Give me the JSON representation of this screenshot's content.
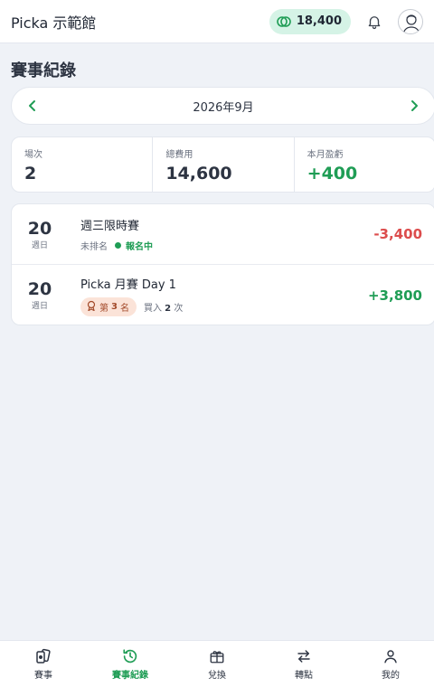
{
  "header": {
    "title": "Picka 示範館",
    "coins": "18,400",
    "icons": {
      "coin": "coin-icon",
      "bell": "bell-icon",
      "avatar": "avatar-icon"
    }
  },
  "page": {
    "title": "賽事紀錄"
  },
  "month_nav": {
    "label": "2026年9月",
    "prev_icon": "chevron-left-icon",
    "next_icon": "chevron-right-icon"
  },
  "stats": [
    {
      "label": "場次",
      "value": "2"
    },
    {
      "label": "總費用",
      "value": "14,600"
    },
    {
      "label": "本月盈虧",
      "value": "+400"
    }
  ],
  "events": [
    {
      "day": "20",
      "weekday": "週日",
      "name": "週三限時賽",
      "rank_text": "未排名",
      "status": "報名中",
      "amount": "-3,400"
    },
    {
      "day": "20",
      "weekday": "週日",
      "name": "Picka 月賽 Day 1",
      "rank_prefix": "第",
      "rank_num": "3",
      "rank_suffix": "名",
      "buyin_prefix": "買入",
      "buyin_num": "2",
      "buyin_suffix": "次",
      "amount": "+3,800"
    }
  ],
  "bottom_nav": [
    {
      "label": "賽事",
      "icon": "cards-icon"
    },
    {
      "label": "賽事紀錄",
      "icon": "history-icon",
      "active": true
    },
    {
      "label": "兌換",
      "icon": "gift-icon"
    },
    {
      "label": "轉點",
      "icon": "transfer-icon"
    },
    {
      "label": "我的",
      "icon": "user-icon"
    }
  ],
  "colors": {
    "accent": "#1f9d55",
    "negative": "#dc4c4c",
    "background": "#eff2f7",
    "rank_pill": "#fbe3d8"
  }
}
